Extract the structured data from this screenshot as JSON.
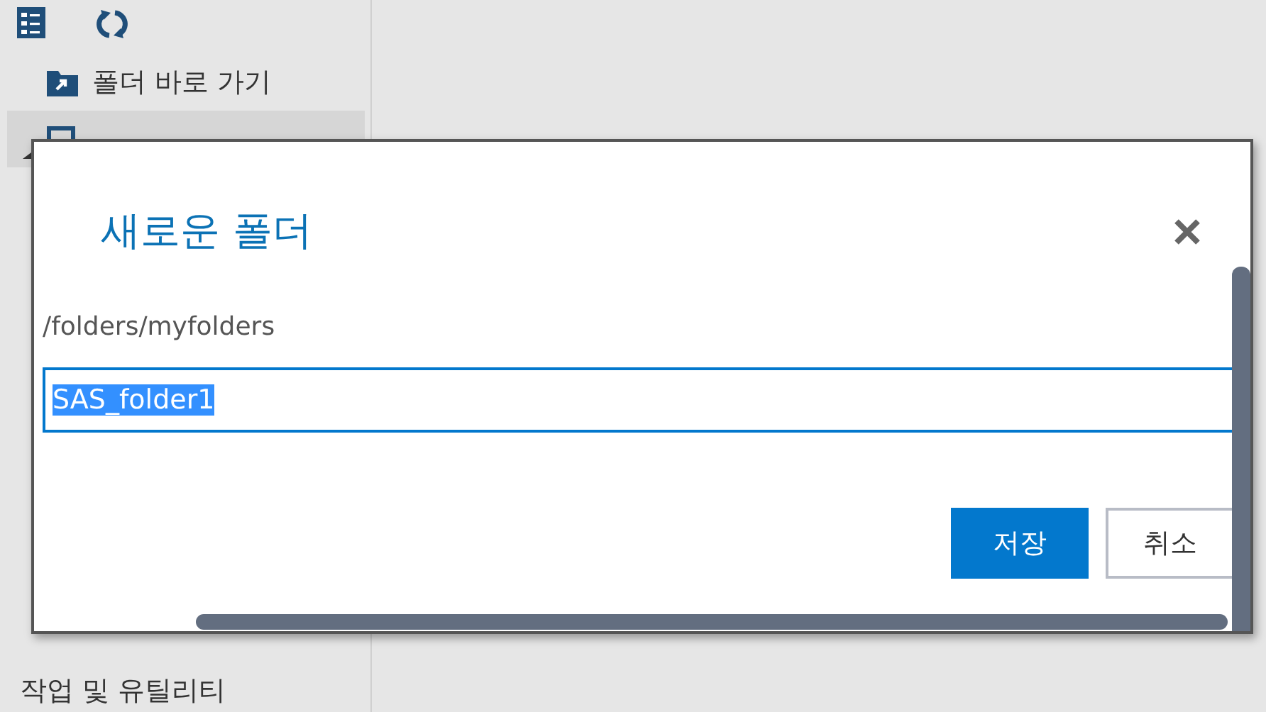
{
  "sidebar": {
    "items": [
      {
        "label": "폴더 바로 가기",
        "selected": false
      },
      {
        "selected": true
      }
    ],
    "section_label": "작업 및 유틸리티"
  },
  "dialog": {
    "title": "새로운 폴더",
    "path": "/folders/myfolders",
    "field": {
      "value": "SAS_folder1",
      "selected": true
    },
    "buttons": [
      {
        "label": "저장",
        "kind": "primary"
      },
      {
        "label": "취소",
        "kind": "secondary"
      }
    ]
  }
}
